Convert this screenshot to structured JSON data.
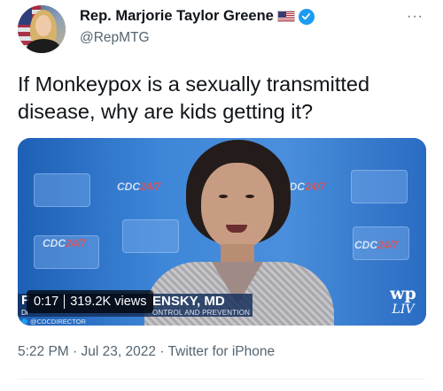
{
  "author": {
    "display_name": "Rep. Marjorie Taylor Greene",
    "handle": "@RepMTG",
    "flag_icon": "us-flag-icon",
    "verified_icon": "verified-badge-icon",
    "verified_color": "#1d9bf0"
  },
  "more_menu": {
    "label": "···"
  },
  "tweet": {
    "text": "If Monkeypox is a sexually transmitted disease, why are kids getting it?"
  },
  "media": {
    "duration": "0:17",
    "views": "319.2K views",
    "lower_third": {
      "name_fragment": "ENSKY, MD",
      "title_fragment": "ONTROL AND PREVENTION",
      "left_initial": "F",
      "left_sub": "Di",
      "source_handle": "@CDCDIRECTOR"
    },
    "backdrop_logo_text": "CDC",
    "backdrop_logo_suffix": "24/7",
    "watermark": {
      "mark": "wp",
      "live": "LIV"
    }
  },
  "meta": {
    "time": "5:22 PM",
    "date": "Jul 23, 2022",
    "source": "Twitter for iPhone",
    "separator": "·"
  },
  "colors": {
    "text_primary": "#0f1419",
    "text_secondary": "#536471",
    "accent": "#1d9bf0"
  }
}
